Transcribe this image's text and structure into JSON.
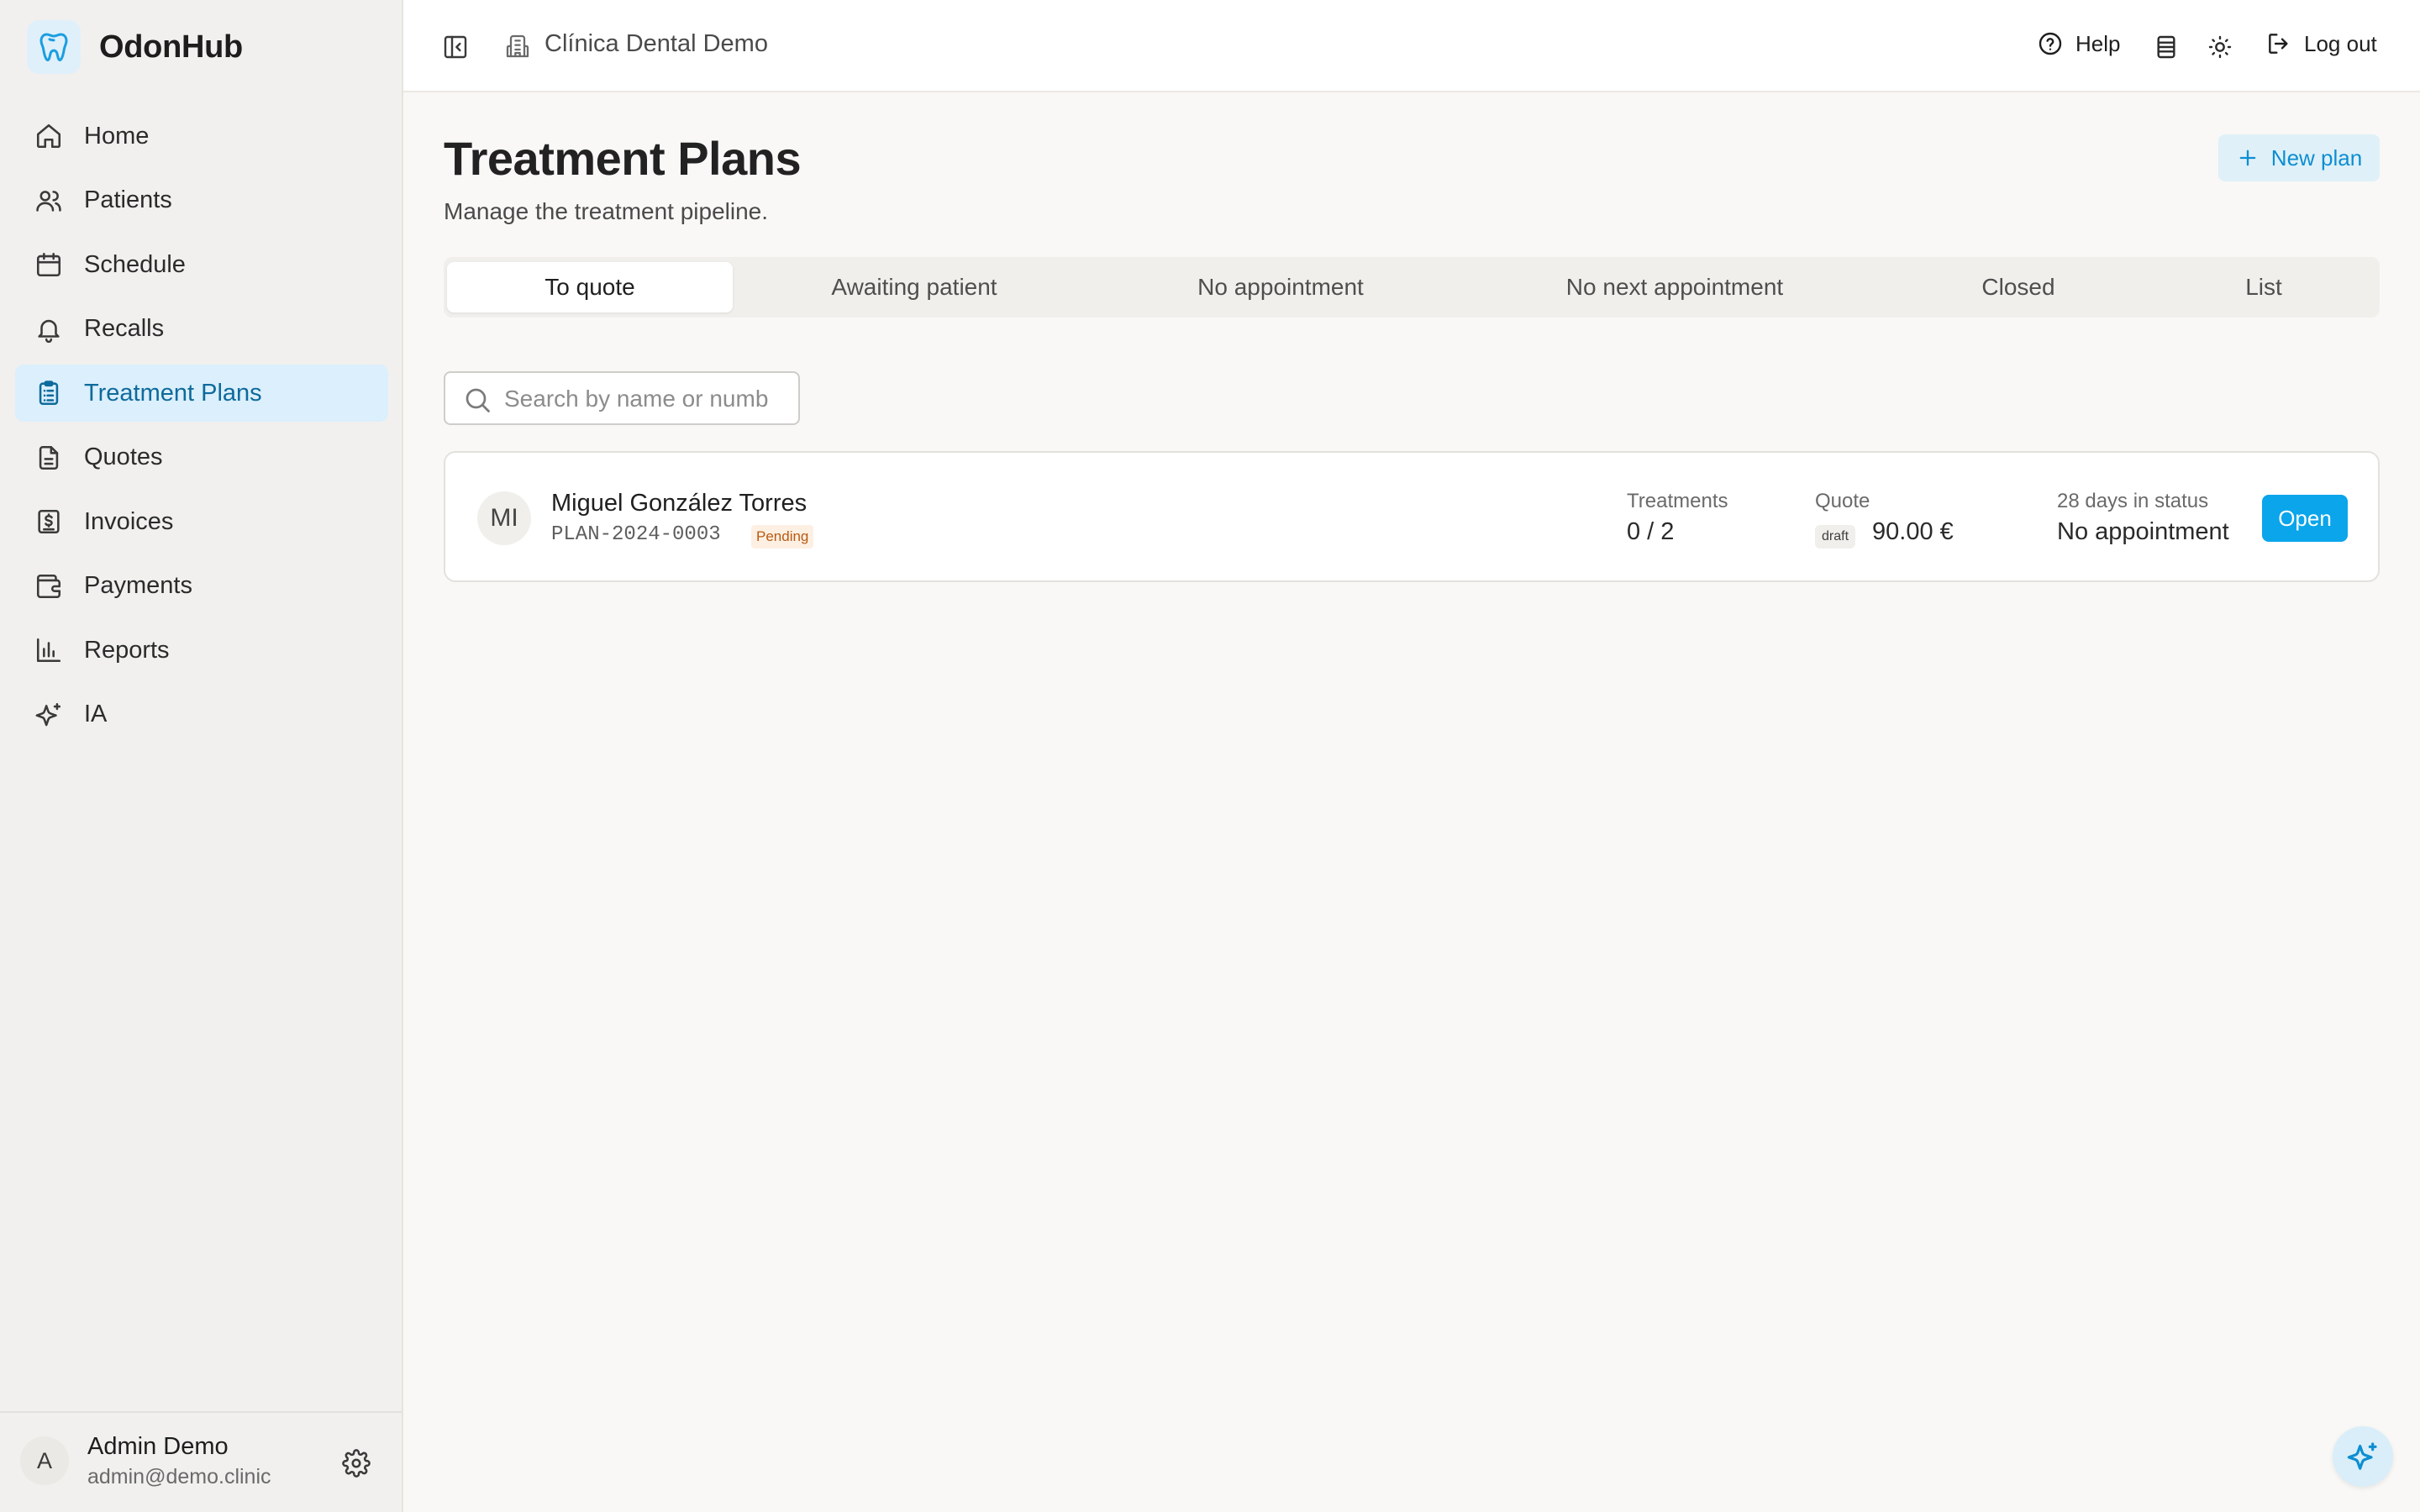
{
  "app": {
    "name": "OdonHub"
  },
  "sidebar": {
    "items": [
      {
        "label": "Home",
        "icon": "home-icon"
      },
      {
        "label": "Patients",
        "icon": "users-icon"
      },
      {
        "label": "Schedule",
        "icon": "calendar-icon"
      },
      {
        "label": "Recalls",
        "icon": "bell-icon"
      },
      {
        "label": "Treatment Plans",
        "icon": "clipboard-icon",
        "active": true
      },
      {
        "label": "Quotes",
        "icon": "document-icon"
      },
      {
        "label": "Invoices",
        "icon": "invoice-icon"
      },
      {
        "label": "Payments",
        "icon": "wallet-icon"
      },
      {
        "label": "Reports",
        "icon": "bar-chart-icon"
      },
      {
        "label": "IA",
        "icon": "sparkles-icon"
      }
    ],
    "user": {
      "initial": "A",
      "name": "Admin Demo",
      "email": "admin@demo.clinic"
    }
  },
  "topbar": {
    "clinic": "Clínica Dental Demo",
    "help": "Help",
    "logout": "Log out"
  },
  "page": {
    "title": "Treatment Plans",
    "subtitle": "Manage the treatment pipeline.",
    "new_plan": "New plan"
  },
  "tabs": [
    {
      "label": "To quote",
      "active": true
    },
    {
      "label": "Awaiting patient"
    },
    {
      "label": "No appointment"
    },
    {
      "label": "No next appointment"
    },
    {
      "label": "Closed"
    },
    {
      "label": "List"
    }
  ],
  "search": {
    "placeholder": "Search by name or numb"
  },
  "plans": [
    {
      "initials": "MI",
      "patient": "Miguel González Torres",
      "code": "PLAN-2024-0003",
      "status": "Pending",
      "treatments_label": "Treatments",
      "treatments_value": "0 / 2",
      "quote_label": "Quote",
      "quote_status": "draft",
      "quote_value": "90.00 €",
      "days_label": "28 days in status",
      "days_value": "No appointment",
      "open": "Open"
    }
  ],
  "colors": {
    "accent": "#0aa5ea",
    "active_nav_bg": "#dbeffc",
    "active_nav_text": "#0e6a9c",
    "pending_badge": "#fdf0e3"
  }
}
